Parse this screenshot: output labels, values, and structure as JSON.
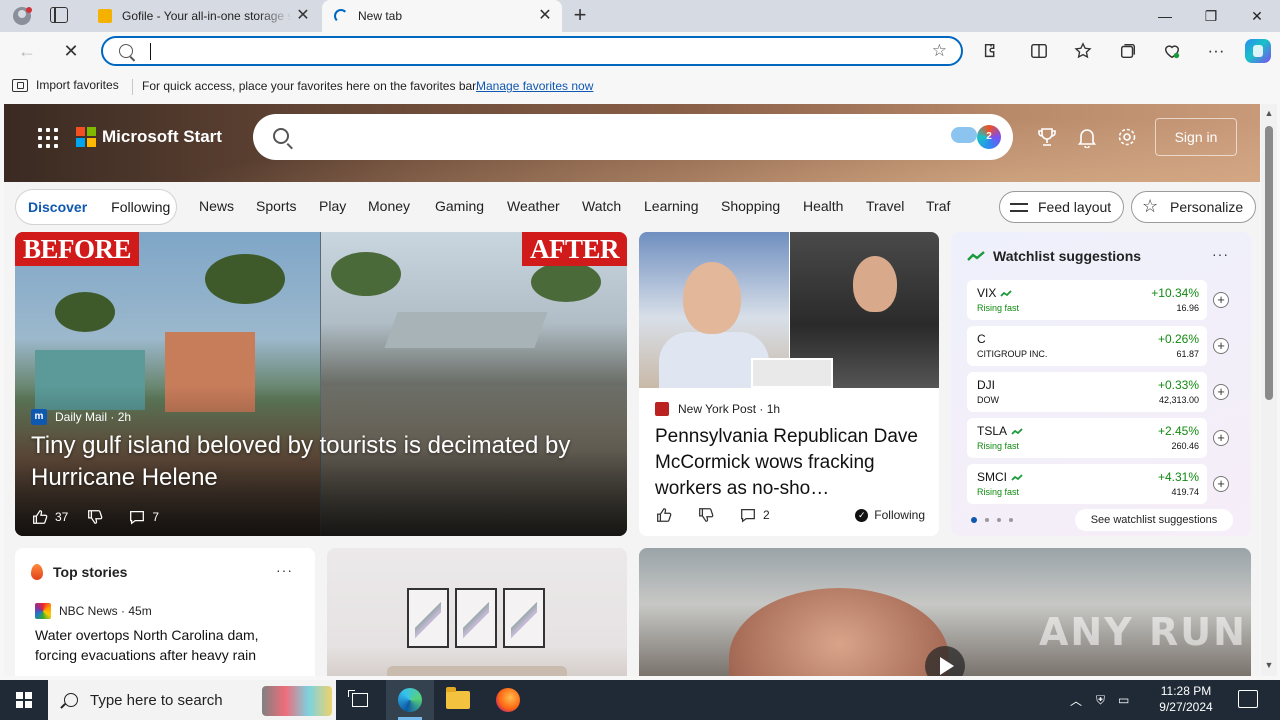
{
  "browser": {
    "tabs": [
      {
        "title": "Gofile - Your all-in-one storage solution",
        "active": false
      },
      {
        "title": "New tab",
        "active": true
      }
    ],
    "address": {
      "value": "",
      "placeholder": ""
    },
    "favorites_bar": {
      "import_label": "Import favorites",
      "message": "For quick access, place your favorites here on the favorites bar.",
      "manage_link": "Manage favorites now"
    },
    "accent": "#0067c0"
  },
  "msn": {
    "brand": "Microsoft Start",
    "copilot_badge": "2",
    "signin_label": "Sign in",
    "feed_tabs": [
      "Discover",
      "Following"
    ],
    "categories": [
      "News",
      "Sports",
      "Play",
      "Money",
      "Gaming",
      "Weather",
      "Watch",
      "Learning",
      "Shopping",
      "Health",
      "Travel",
      "Traf"
    ],
    "feed_layout_label": "Feed layout",
    "personalize_label": "Personalize",
    "hero": {
      "stamp_before": "BEFORE",
      "stamp_after": "AFTER",
      "source": "Daily Mail",
      "age": "2h",
      "title": "Tiny gulf island beloved by tourists is decimated by Hurricane Helene",
      "likes": "37",
      "comments": "7"
    },
    "story2": {
      "source": "New York Post",
      "age": "1h",
      "title": "Pennsylvania Republican Dave McCormick wows fracking workers as no-sho…",
      "comments": "2",
      "follow_label": "Following"
    },
    "watchlist": {
      "title": "Watchlist suggestions",
      "stocks": [
        {
          "symbol": "VIX",
          "sub": "Rising fast",
          "change": "+10.34%",
          "price": "16.96",
          "trending": true
        },
        {
          "symbol": "C",
          "sub": "CITIGROUP INC.",
          "change": "+0.26%",
          "price": "61.87",
          "trending": false
        },
        {
          "symbol": "DJI",
          "sub": "DOW",
          "change": "+0.33%",
          "price": "42,313.00",
          "trending": false
        },
        {
          "symbol": "TSLA",
          "sub": "Rising fast",
          "change": "+2.45%",
          "price": "260.46",
          "trending": true
        },
        {
          "symbol": "SMCI",
          "sub": "Rising fast",
          "change": "+4.31%",
          "price": "419.74",
          "trending": true
        }
      ],
      "see_more": "See watchlist suggestions",
      "positive_color": "#118a11"
    },
    "top_stories": {
      "title": "Top stories",
      "source": "NBC News",
      "age": "45m",
      "headline": "Water overtops North Carolina dam, forcing evacuations after heavy rain"
    },
    "watermark": "ANY RUN"
  },
  "taskbar": {
    "search_placeholder": "Type here to search",
    "time": "11:28 PM",
    "date": "9/27/2024"
  }
}
